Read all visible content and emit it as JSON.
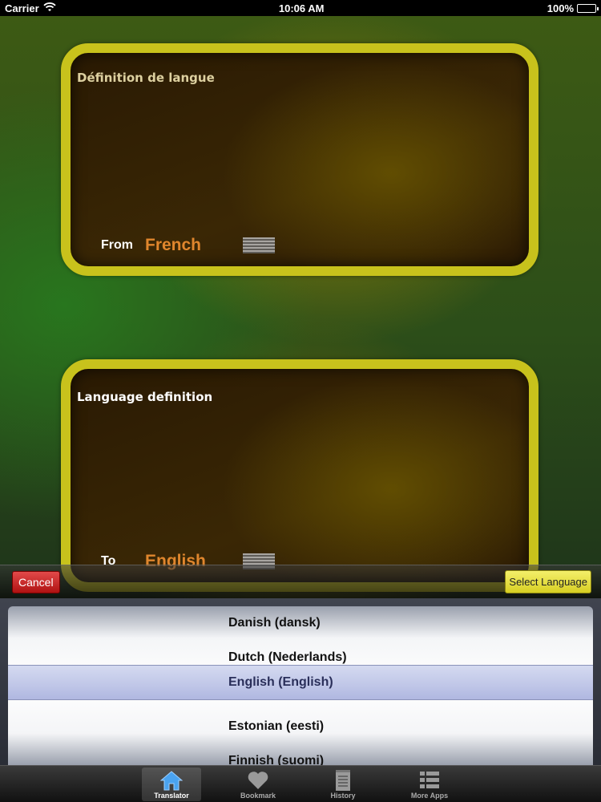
{
  "status_bar": {
    "carrier": "Carrier",
    "time": "10:06 AM",
    "battery": "100%"
  },
  "source_panel": {
    "title": "Définition de langue",
    "label": "From",
    "language": "French"
  },
  "target_panel": {
    "title": "Language definition",
    "label": "To",
    "language": "English"
  },
  "toolbar": {
    "cancel_label": "Cancel",
    "select_label": "Select Language"
  },
  "picker": {
    "options": [
      "Danish (dansk)",
      "Dutch (Nederlands)",
      "Estonian (eesti)",
      "Finnish (suomi)"
    ],
    "selected": "English (English)"
  },
  "tabs": [
    {
      "label": "Translator",
      "icon": "house-icon"
    },
    {
      "label": "Bookmark",
      "icon": "heart-icon"
    },
    {
      "label": "History",
      "icon": "notepad-icon"
    },
    {
      "label": "More Apps",
      "icon": "list-icon"
    }
  ],
  "colors": {
    "panel_border": "#c8c21c",
    "language_text": "#e0862d",
    "cancel": "#c41e1e",
    "select": "#e6df3c"
  }
}
